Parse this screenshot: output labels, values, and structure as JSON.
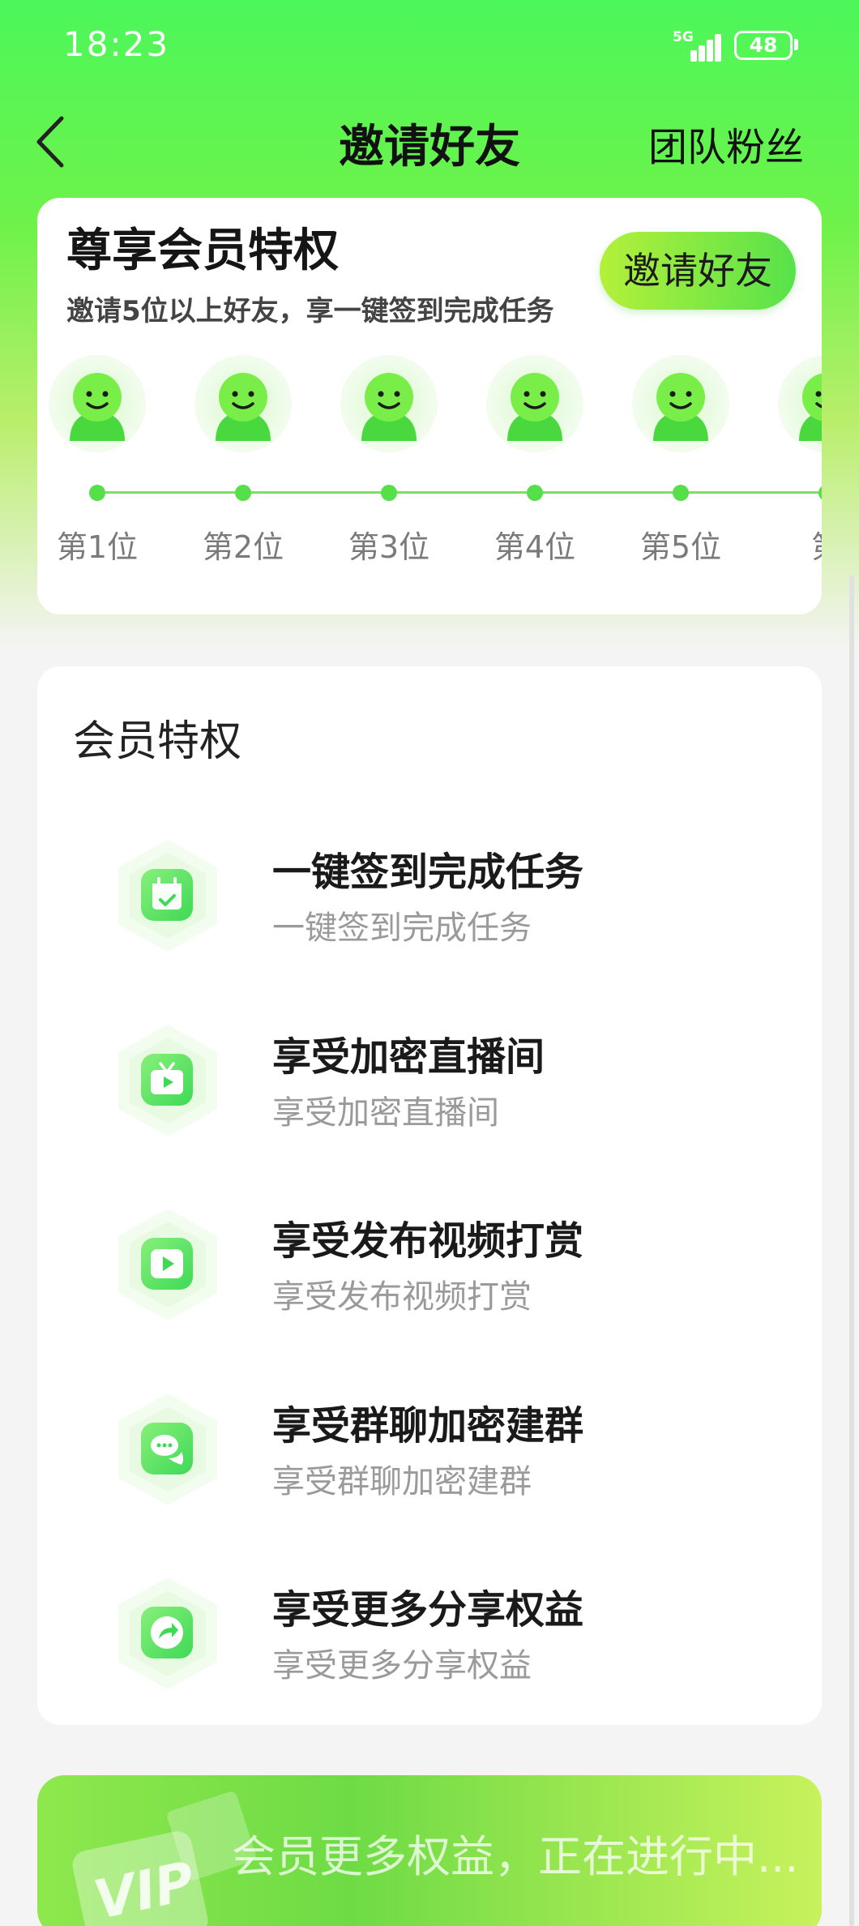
{
  "status_bar": {
    "time": "18:23",
    "network": "5G",
    "battery": "48"
  },
  "nav": {
    "title": "邀请好友",
    "right_action": "团队粉丝",
    "back_icon": "chevron-left-icon"
  },
  "invite_card": {
    "title": "尊享会员特权",
    "subtitle": "邀请5位以上好友，享一键签到完成任务",
    "button": "邀请好友",
    "slots": [
      {
        "label": "第1位"
      },
      {
        "label": "第2位"
      },
      {
        "label": "第3位"
      },
      {
        "label": "第4位"
      },
      {
        "label": "第5位"
      },
      {
        "label": "第"
      }
    ]
  },
  "privileges": {
    "heading": "会员特权",
    "items": [
      {
        "icon": "calendar-check-icon",
        "title": "一键签到完成任务",
        "desc": "一键签到完成任务"
      },
      {
        "icon": "tv-play-icon",
        "title": "享受加密直播间",
        "desc": "享受加密直播间"
      },
      {
        "icon": "video-play-icon",
        "title": "享受发布视频打赏",
        "desc": "享受发布视频打赏"
      },
      {
        "icon": "chat-bubbles-icon",
        "title": "享受群聊加密建群",
        "desc": "享受群聊加密建群"
      },
      {
        "icon": "share-arrow-icon",
        "title": "享受更多分享权益",
        "desc": "享受更多分享权益"
      }
    ]
  },
  "vip_banner": {
    "logo": "VIP",
    "text": "会员更多权益，正在进行中..."
  },
  "colors": {
    "accent": "#55e04a",
    "gradient_top": "#4cf75a",
    "text_dark": "#1a1a1a",
    "text_muted": "#9a9a9a"
  }
}
